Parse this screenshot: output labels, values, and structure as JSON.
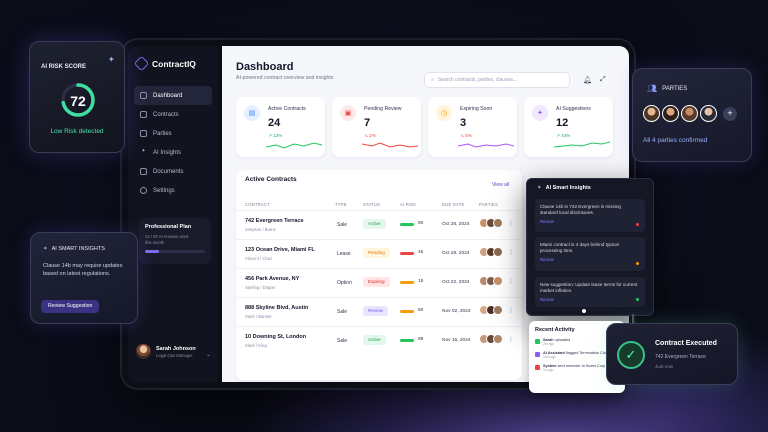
{
  "app": {
    "name": "ContractIQ"
  },
  "sidebar": {
    "items": [
      {
        "label": "Dashboard",
        "icon": "grid-icon",
        "active": true
      },
      {
        "label": "Contracts",
        "icon": "document-icon"
      },
      {
        "label": "Parties",
        "icon": "users-icon"
      },
      {
        "label": "AI Insights",
        "icon": "sparkle-icon"
      },
      {
        "label": "Documents",
        "icon": "folder-icon"
      },
      {
        "label": "Settings",
        "icon": "gear-icon"
      }
    ],
    "plan": {
      "title": "Professional Plan",
      "usage": "12 / 50 AI reviews used",
      "period": "this month",
      "progress": 0.24
    },
    "user": {
      "name": "Sarah Johnson",
      "role": "Legal Ops Manager"
    }
  },
  "header": {
    "title": "Dashboard",
    "subtitle": "AI-powered contract overview and insights",
    "search_placeholder": "Search contracts, parties, clauses..."
  },
  "stats": [
    {
      "label": "Active Contracts",
      "value": "24",
      "delta": "12%",
      "color": "#3b82f6"
    },
    {
      "label": "Pending Review",
      "value": "7",
      "delta": "2%",
      "color": "#ef4444"
    },
    {
      "label": "Expiring Soon",
      "value": "3",
      "delta": "5%",
      "color": "#f59e0b"
    },
    {
      "label": "AI Suggestions",
      "value": "12",
      "delta": "44%",
      "color": "#8b5cf6"
    }
  ],
  "table": {
    "title": "Active Contracts",
    "view_all": "View all",
    "columns": [
      "CONTRACT",
      "TYPE",
      "STATUS",
      "AI RISK",
      "DUE DATE",
      "PARTIES"
    ],
    "rows": [
      {
        "name": "742 Evergreen Terrace",
        "parties": "Simpson / Burns",
        "type": "Sale",
        "status": "Active",
        "risk": "90",
        "due": "Oct 26, 2024"
      },
      {
        "name": "123 Ocean Drive, Miami FL",
        "parties": "Vincent / Chez",
        "type": "Lease",
        "status": "Pending",
        "risk": "45",
        "due": "Oct 28, 2024"
      },
      {
        "name": "456 Park Avenue, NY",
        "parties": "Sterling / Draper",
        "type": "Option",
        "status": "Expiring",
        "risk": "15",
        "due": "Oct 22, 2024"
      },
      {
        "name": "888 Skyline Blvd, Austin",
        "parties": "Stark / Banner",
        "type": "Sale",
        "status": "Review",
        "risk": "60",
        "due": "Nov 02, 2024"
      },
      {
        "name": "10 Downing St, London",
        "parties": "Stark / King",
        "type": "Sale",
        "status": "Active",
        "risk": "88",
        "due": "Nov 15, 2024"
      }
    ]
  },
  "ai_panel": {
    "title": "AI Smart Insights",
    "insights": [
      {
        "text": "Clause 14b in 742 Evergreen is missing standard local disclosures.",
        "link": "Review",
        "dot": "#ef4444"
      },
      {
        "text": "Miami contract is 4 days behind typical processing time.",
        "link": "Review",
        "dot": "#f59e0b"
      },
      {
        "text": "New suggestion: Update lease terms for current market inflation.",
        "link": "Review",
        "dot": "#22c55e"
      }
    ]
  },
  "recent": {
    "title": "Recent Activity",
    "items": [
      {
        "who": "Sarah",
        "what": "uploaded",
        "when": "2m ago",
        "color": "#22c55e"
      },
      {
        "who": "AI Assistant",
        "what": "flagged Termination Clause",
        "when": "15m ago",
        "color": "#8b5cf6"
      },
      {
        "who": "System",
        "what": "sent reminder to Burns Corp",
        "when": "1h ago",
        "color": "#ef4444"
      }
    ]
  },
  "risk_card": {
    "label": "AI RISK SCORE",
    "value": "72",
    "status": "Low Risk detected",
    "progress": 0.72
  },
  "insight_card": {
    "title": "AI SMART INSIGHTS",
    "body": "Clause 14b may require updates based on latest regulations.",
    "button": "Review Suggestion"
  },
  "parties_card": {
    "title": "PARTIES",
    "footer": "All 4 parties confirmed"
  },
  "executed_card": {
    "title": "Contract Executed",
    "subtitle": "742 Evergreen Terrace",
    "time": "Just now"
  }
}
